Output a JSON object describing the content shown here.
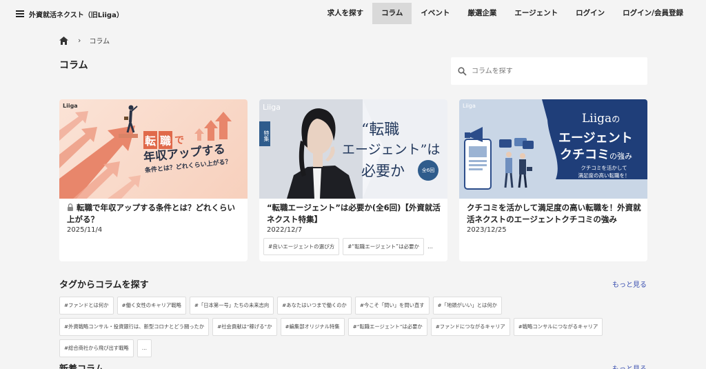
{
  "header": {
    "site_title": "外資就活ネクスト（旧Liiga）",
    "nav": [
      "求人を探す",
      "コラム",
      "イベント",
      "厳選企業",
      "エージェント",
      "ログイン",
      "ログイン/会員登録"
    ]
  },
  "breadcrumb": {
    "current": "コラム"
  },
  "page": {
    "title": "コラム"
  },
  "search": {
    "placeholder": "コラムを探す"
  },
  "cards": [
    {
      "title": "転職で年収アップする条件とは？どれくらい上がる？",
      "date": "2025/11/4",
      "locked": true,
      "thumb": {
        "brand": "Liiga",
        "line1a": "転",
        "line1b": "職",
        "line1c": "で",
        "line2": "年収アップする",
        "line3": "条件とは？どれくらい上がる？"
      },
      "tags": []
    },
    {
      "title": "“転職エージェント”は必要か(全6回)【外資就活ネクスト特集】",
      "date": "2022/12/7",
      "locked": false,
      "thumb": {
        "brand": "Liiga",
        "badge": "特集",
        "line1": "“転職",
        "line2": "エージェント”は",
        "line3": "必要か",
        "circle": "全6回"
      },
      "tags": [
        "#良いエージェントの選び方",
        "#“転職エージェント”は必要か"
      ],
      "more": "…"
    },
    {
      "title": "クチコミを活かして満足度の高い転職を！外資就活ネクストのエージェントクチコミの強み",
      "date": "2023/12/25",
      "locked": false,
      "thumb": {
        "brand": "Liiga",
        "line1a": "Liiga",
        "line1b": "の",
        "line2": "エージェント",
        "line3": "クチコミ",
        "line3b": "の強み",
        "sub1": "クチコミを活かして",
        "sub2": "満足度の高い転職を！"
      },
      "tags": []
    }
  ],
  "tag_section": {
    "title": "タグからコラムを探す",
    "more": "もっと見る",
    "tags": [
      "#ファンドとは何か",
      "#働く女性のキャリア戦略",
      "#「日本第一号」たちの未来志向",
      "#あなたはいつまで働くのか",
      "#今こそ「問い」を問い直す",
      "#「地頭がいい」とは何か",
      "#外資戦略コンサル・投資銀行は、新型コロナとどう闘ったか",
      "#社会貢献は“稼げる”か",
      "#編集部オリジナル特集",
      "#“転職エージェント”は必要か",
      "#ファンドにつながるキャリア",
      "#戦略コンサルにつながるキャリア",
      "#総合商社から飛び出す戦略",
      "…"
    ]
  },
  "new_section": {
    "title": "新着コラム",
    "more": "もっと見る"
  }
}
